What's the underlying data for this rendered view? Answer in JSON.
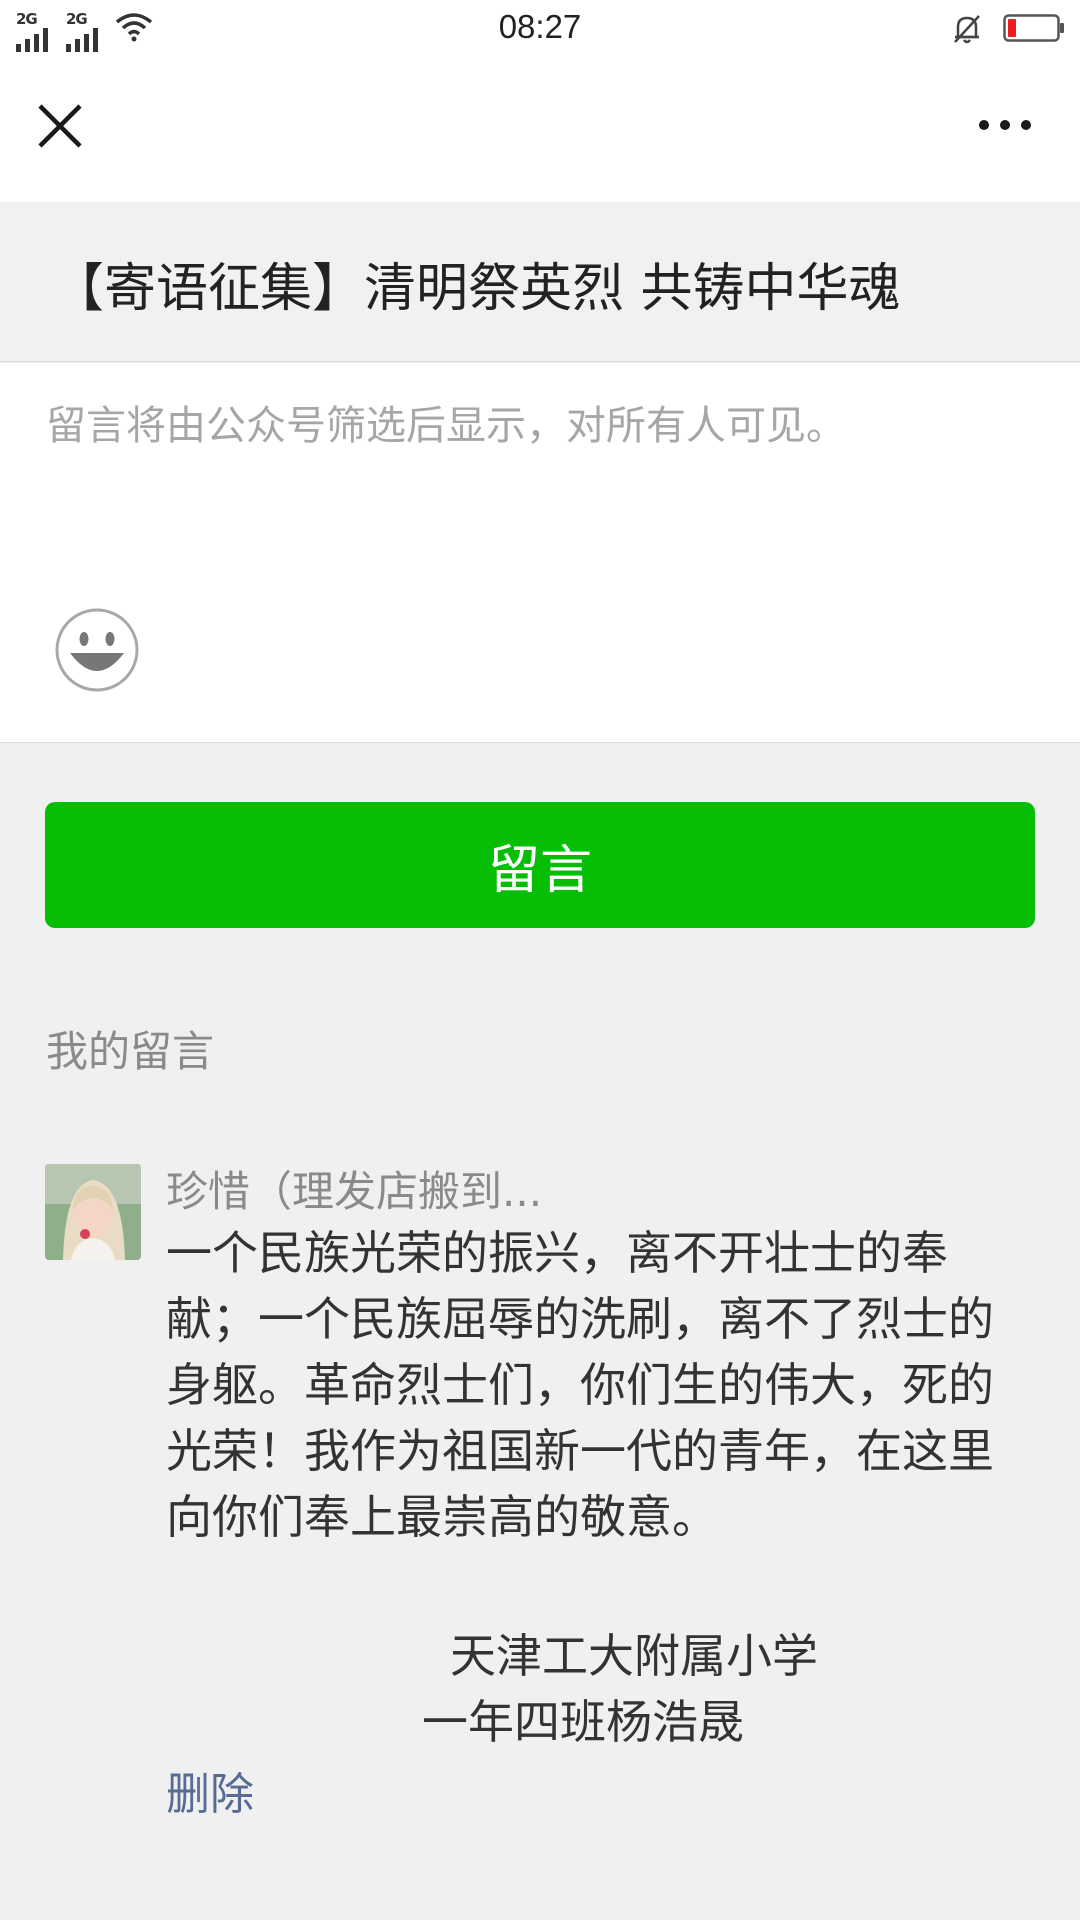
{
  "status_bar": {
    "network_1": "2G",
    "network_2": "2G",
    "time": "08:27",
    "battery_color": "#ee1d1d"
  },
  "nav": {
    "close_icon": "close-icon",
    "more_icon": "more-dots-icon"
  },
  "article": {
    "title": "【寄语征集】清明祭英烈 共铸中华魂"
  },
  "compose": {
    "placeholder": "留言将由公众号筛选后显示，对所有人可见。",
    "emoji_icon": "emoji-smile-icon"
  },
  "submit": {
    "label": "留言",
    "color": "#07be06"
  },
  "my_comments": {
    "section_label": "我的留言",
    "items": [
      {
        "username": "珍惜（理发店搬到...",
        "body": "一个民族光荣的振兴，离不开壮士的奉献；一个民族屈辱的洗刷，离不了烈士的身躯。革命烈士们，你们生的伟大，死的光荣！我作为祖国新一代的青年，在这里向你们奉上最崇高的敬意。",
        "signature_line_1": "天津工大附属小学",
        "signature_line_2": "一年四班杨浩晟",
        "delete_label": "删除"
      }
    ]
  }
}
